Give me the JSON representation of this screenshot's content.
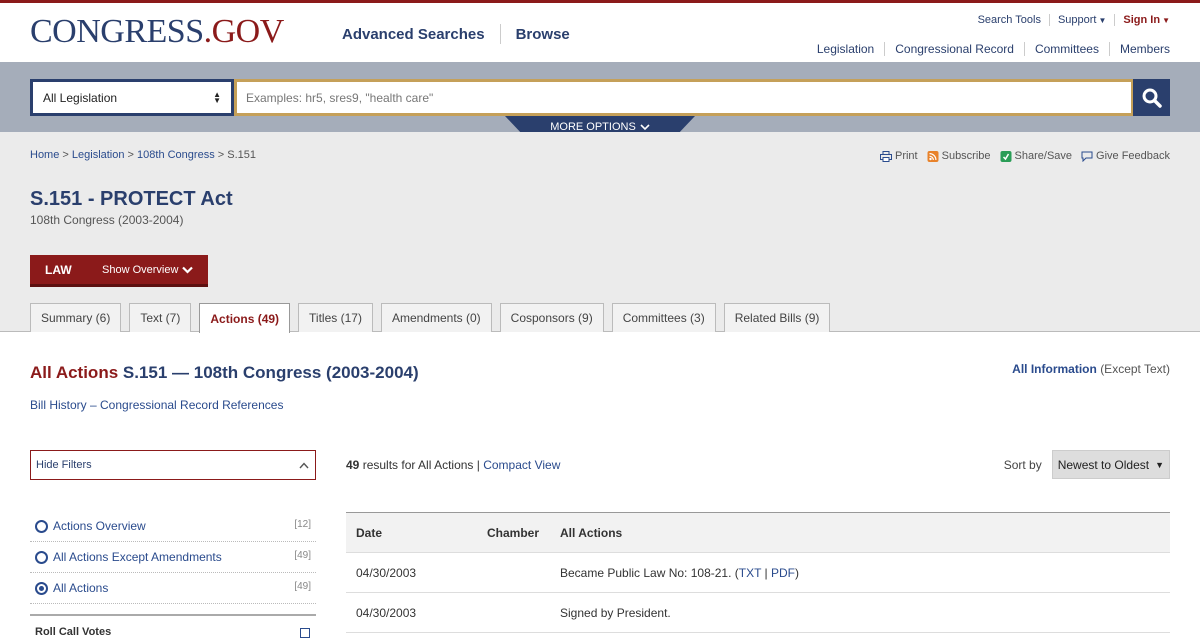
{
  "header": {
    "logo_main": "CONGRESS",
    "logo_suffix": ".GOV",
    "nav": [
      "Advanced Searches",
      "Browse"
    ],
    "utility": {
      "search_tools": "Search Tools",
      "support": "Support",
      "sign_in": "Sign In"
    },
    "secondary": [
      "Legislation",
      "Congressional Record",
      "Committees",
      "Members"
    ]
  },
  "search": {
    "scope": "All Legislation",
    "placeholder": "Examples: hr5, sres9, \"health care\"",
    "more_options": "MORE OPTIONS"
  },
  "breadcrumb": {
    "home": "Home",
    "legislation": "Legislation",
    "congress": "108th Congress",
    "current": "S.151"
  },
  "tools": [
    "Print",
    "Subscribe",
    "Share/Save",
    "Give Feedback"
  ],
  "bill": {
    "title": "S.151 - PROTECT Act",
    "congress": "108th Congress (2003-2004)",
    "status": "LAW",
    "show_overview": "Show Overview"
  },
  "tabs": [
    {
      "label": "Summary (6)",
      "active": false
    },
    {
      "label": "Text (7)",
      "active": false
    },
    {
      "label": "Actions (49)",
      "active": true
    },
    {
      "label": "Titles (17)",
      "active": false
    },
    {
      "label": "Amendments (0)",
      "active": false
    },
    {
      "label": "Cosponsors (9)",
      "active": false
    },
    {
      "label": "Committees (3)",
      "active": false
    },
    {
      "label": "Related Bills (9)",
      "active": false
    }
  ],
  "section": {
    "head_red": "All Actions",
    "head_rest": "S.151 — 108th Congress (2003-2004)",
    "all_info_link": "All Information",
    "all_info_note": "(Except Text)",
    "bill_history": "Bill History – Congressional Record References"
  },
  "filters": {
    "toggle_label": "Hide Filters",
    "items": [
      {
        "label": "Actions Overview",
        "count": "[12]",
        "checked": false
      },
      {
        "label": "All Actions Except Amendments",
        "count": "[49]",
        "checked": false
      },
      {
        "label": "All Actions",
        "count": "[49]",
        "checked": true
      }
    ],
    "rollcall": "Roll Call Votes"
  },
  "results": {
    "count": "49",
    "text": "results for All Actions |",
    "compact_view": "Compact View",
    "sort_label": "Sort by",
    "sort_value": "Newest to Oldest"
  },
  "table": {
    "headers": [
      "Date",
      "Chamber",
      "All Actions"
    ],
    "rows": [
      {
        "date": "04/30/2003",
        "chamber": "",
        "action_prefix": "Became Public Law No: 108-21. (",
        "link1": "TXT",
        "separator": " | ",
        "link2": "PDF",
        "action_suffix": ")"
      },
      {
        "date": "04/30/2003",
        "chamber": "",
        "action": "Signed by President."
      }
    ]
  },
  "colors": {
    "brand_blue": "#2a3f6d",
    "brand_red": "#8b1a1a",
    "search_band": "#a5adba",
    "gold_border": "#c5a059"
  }
}
